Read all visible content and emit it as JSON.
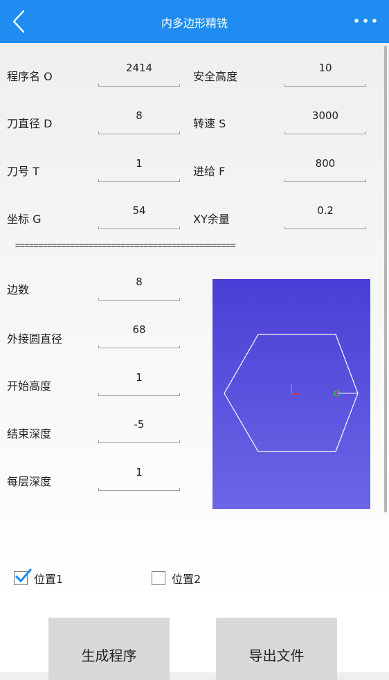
{
  "appbar": {
    "title": "内多边形精铣",
    "back_icon": "chevron-left-icon",
    "more_icon": "more-horizontal-icon",
    "color": "#1e8cf0"
  },
  "params": {
    "program_name": {
      "label": "程序名 O",
      "value": "2414"
    },
    "safe_height": {
      "label": "安全高度",
      "value": "10"
    },
    "tool_diameter": {
      "label": "刀直径 D",
      "value": "8"
    },
    "spindle_speed": {
      "label": "转速 S",
      "value": "3000"
    },
    "tool_number": {
      "label": "刀号 T",
      "value": "1"
    },
    "feed": {
      "label": "进给 F",
      "value": "800"
    },
    "coordinate": {
      "label": "坐标 G",
      "value": "54"
    },
    "xy_allowance": {
      "label": "XY余量",
      "value": "0.2"
    }
  },
  "separator": "================================================",
  "geometry": {
    "sides": {
      "label": "边数",
      "value": "8"
    },
    "circumscribed_diameter": {
      "label": "外接圆直径",
      "value": "68"
    },
    "start_height": {
      "label": "开始高度",
      "value": "1"
    },
    "end_depth": {
      "label": "结束深度",
      "value": "-5"
    },
    "layer_depth": {
      "label": "每层深度",
      "value": "1"
    }
  },
  "preview": {
    "gradient_top": "#4a3fd6",
    "gradient_bottom": "#6a66e6"
  },
  "options": {
    "position1": {
      "label": "位置1",
      "checked": true
    },
    "position2": {
      "label": "位置2",
      "checked": false
    }
  },
  "buttons": {
    "generate": "生成程序",
    "export": "导出文件"
  }
}
